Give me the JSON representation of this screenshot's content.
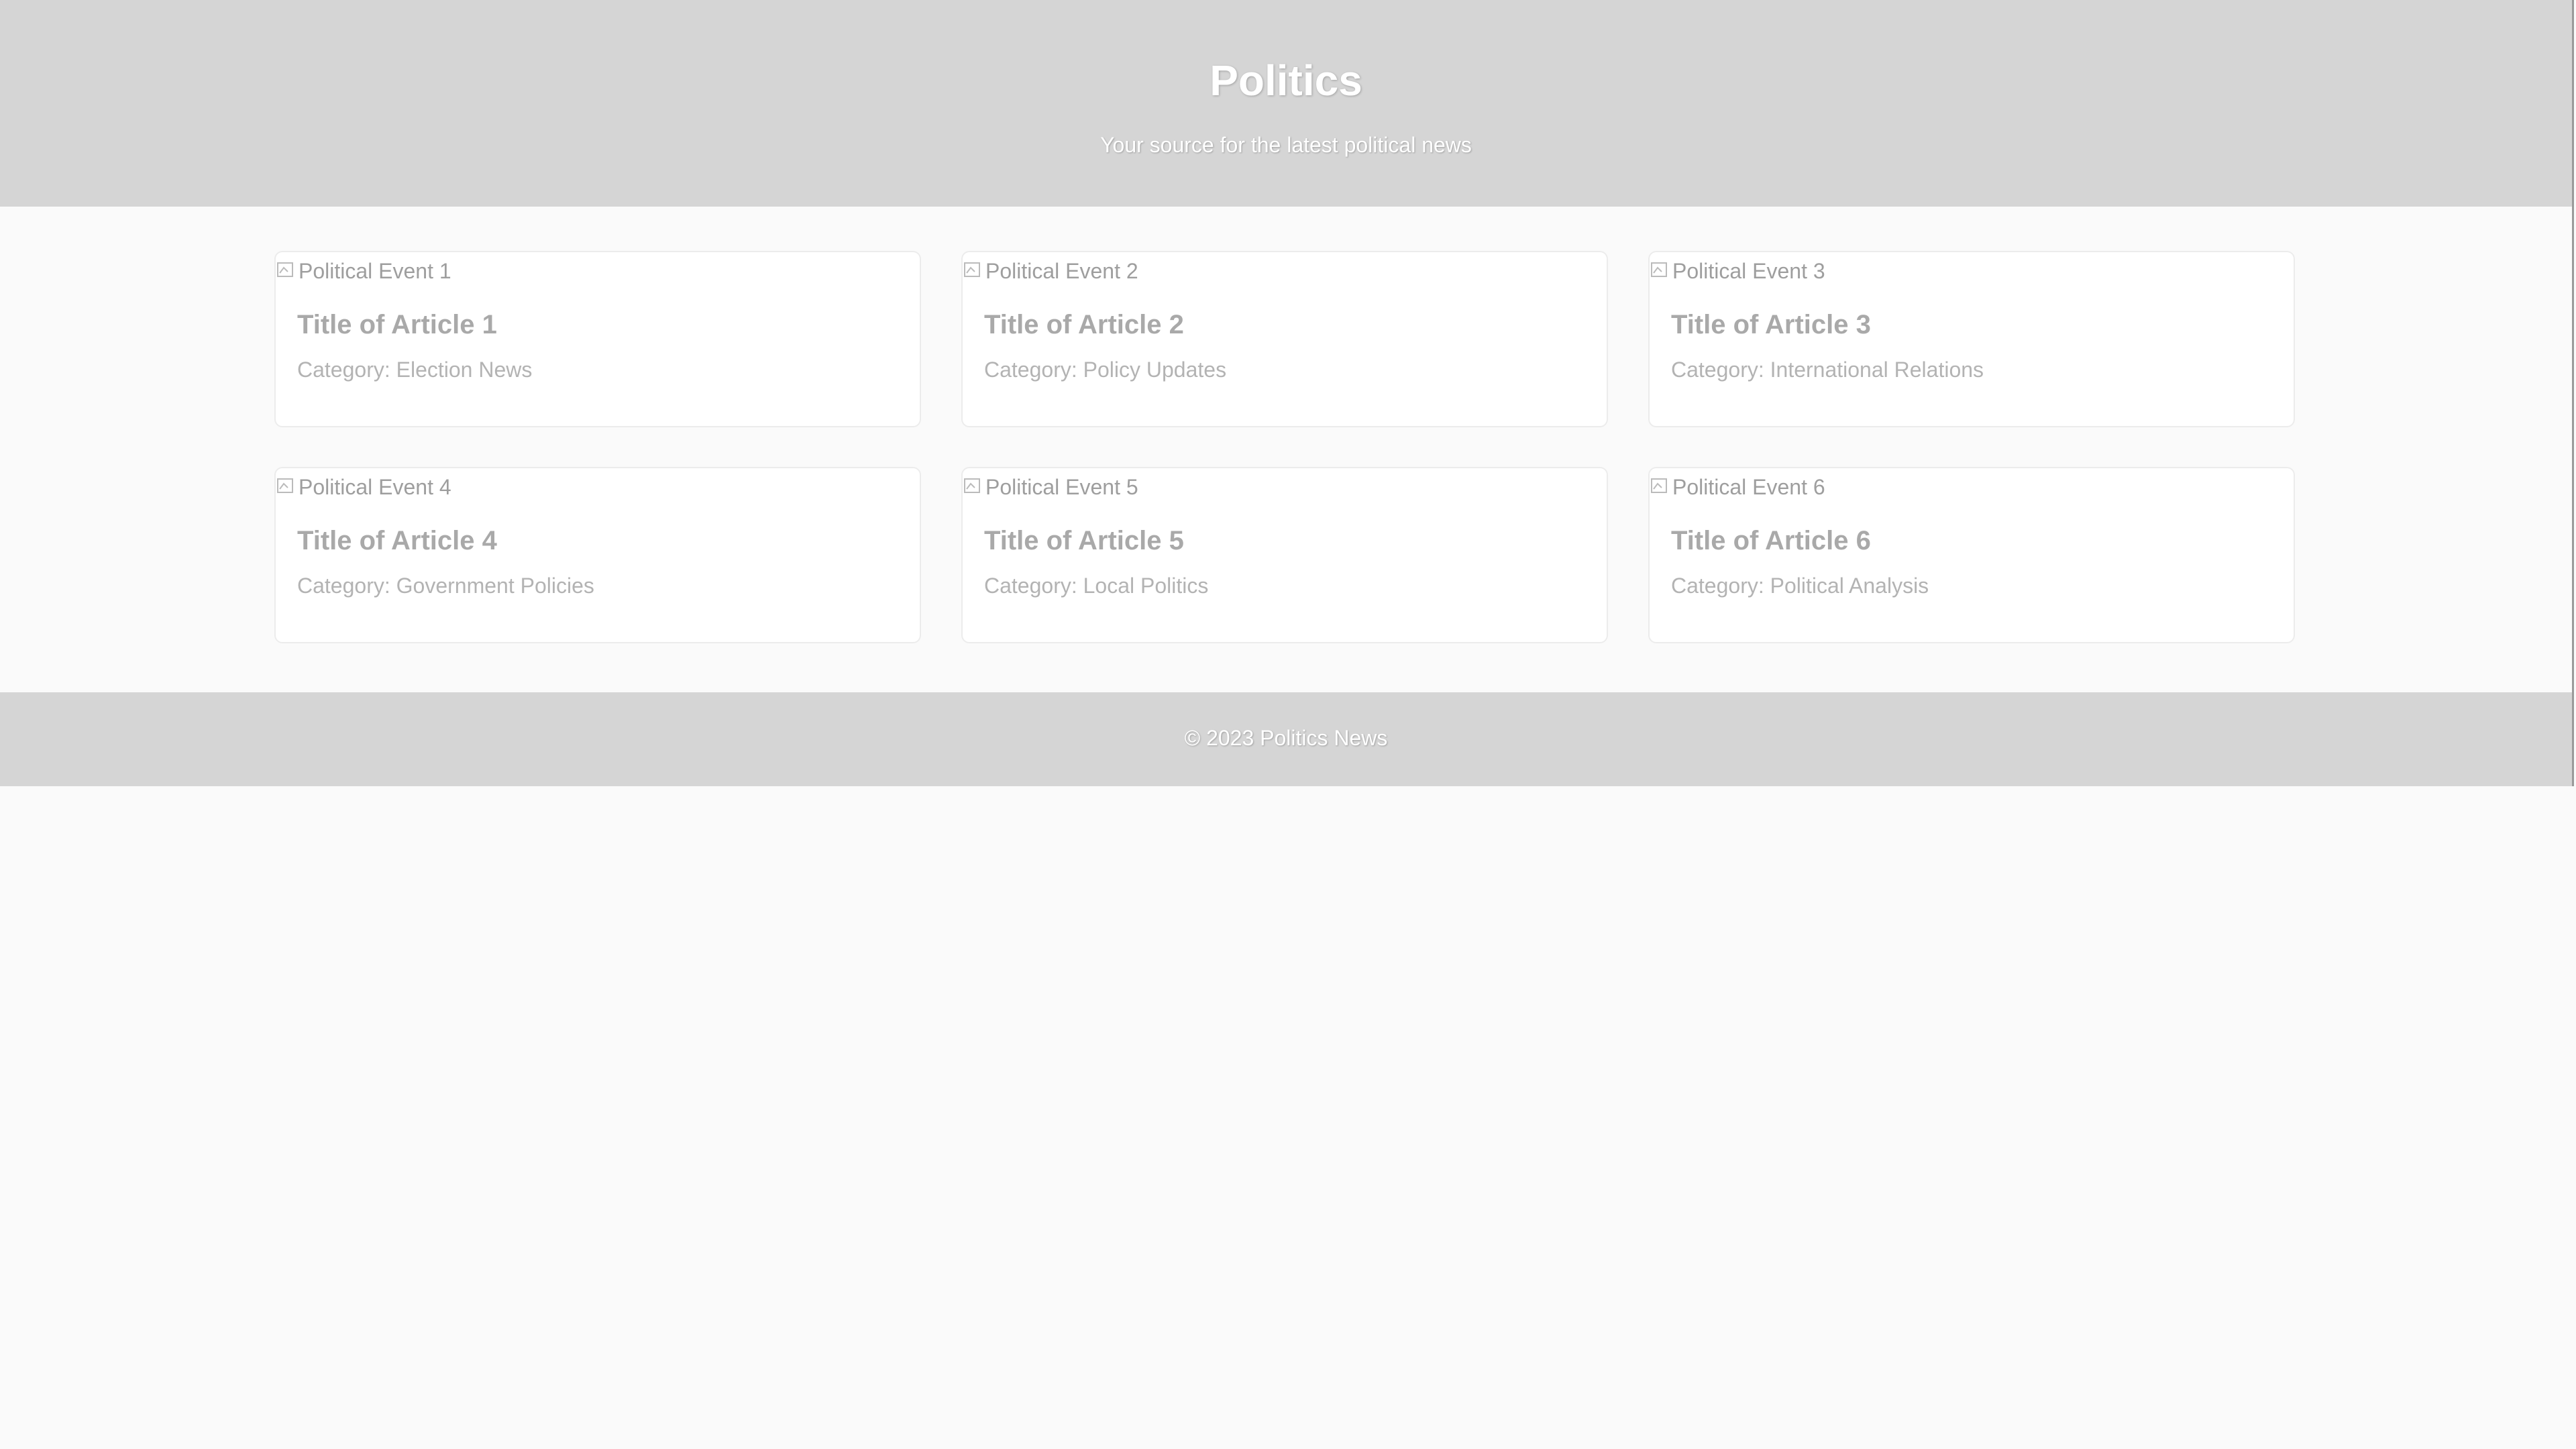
{
  "header": {
    "title": "Politics",
    "tagline": "Your source for the latest political news"
  },
  "articles": [
    {
      "image_alt": "Political Event 1",
      "title": "Title of Article 1",
      "category": "Category: Election News"
    },
    {
      "image_alt": "Political Event 2",
      "title": "Title of Article 2",
      "category": "Category: Policy Updates"
    },
    {
      "image_alt": "Political Event 3",
      "title": "Title of Article 3",
      "category": "Category: International Relations"
    },
    {
      "image_alt": "Political Event 4",
      "title": "Title of Article 4",
      "category": "Category: Government Policies"
    },
    {
      "image_alt": "Political Event 5",
      "title": "Title of Article 5",
      "category": "Category: Local Politics"
    },
    {
      "image_alt": "Political Event 6",
      "title": "Title of Article 6",
      "category": "Category: Political Analysis"
    }
  ],
  "footer": {
    "copyright": "© 2023 Politics News"
  },
  "icons": {
    "image_placeholder": "broken-image-icon"
  },
  "colors": {
    "header_background": "#d5d5d5",
    "page_background": "#fafafa",
    "card_background": "#ffffff"
  }
}
